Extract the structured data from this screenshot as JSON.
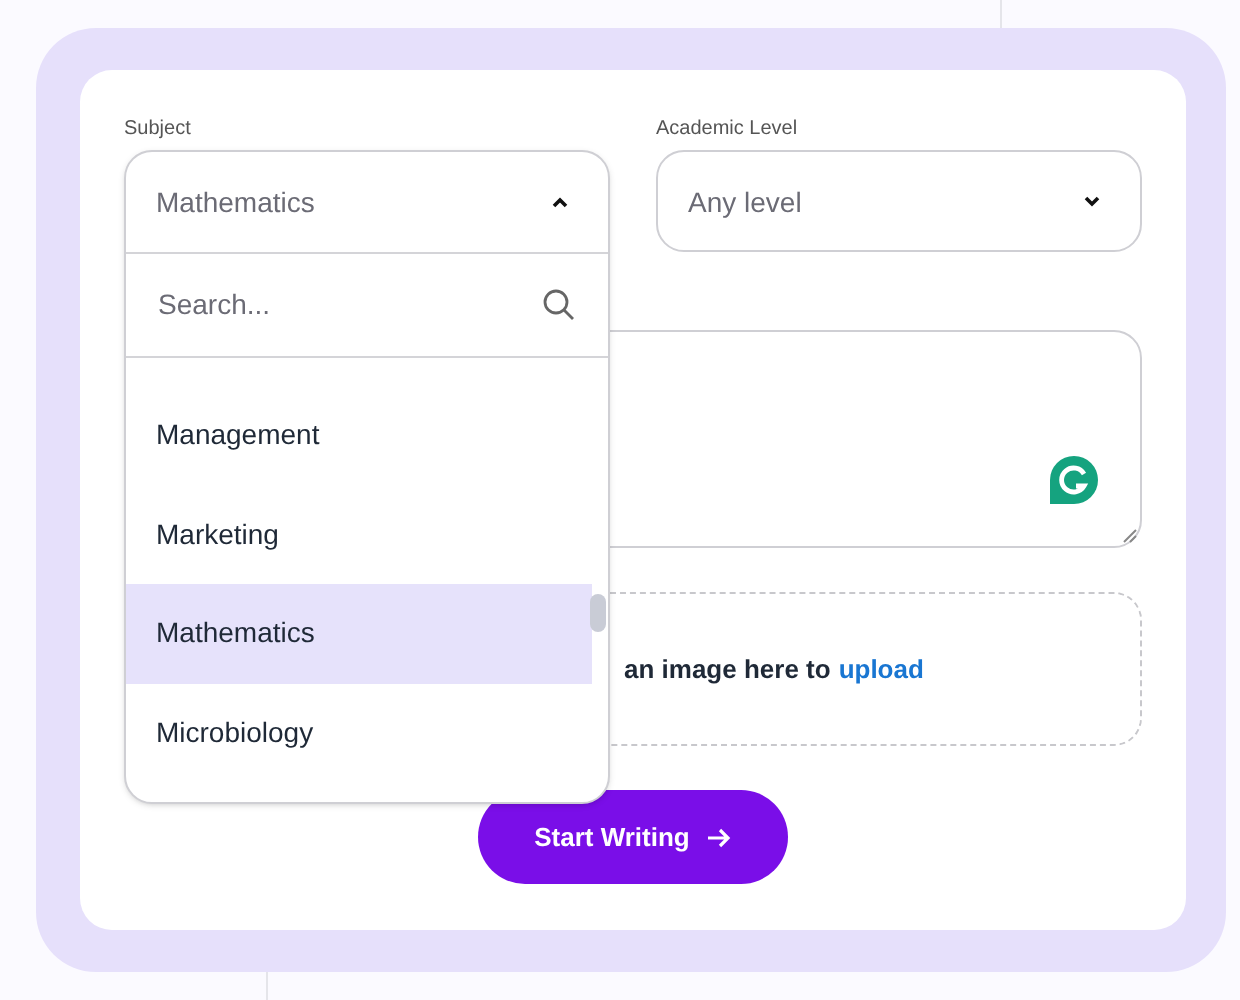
{
  "form": {
    "subject": {
      "label": "Subject",
      "value": "Mathematics",
      "expanded": true,
      "search_placeholder": "Search...",
      "options": [
        {
          "label": "Management",
          "selected": false
        },
        {
          "label": "Marketing",
          "selected": false
        },
        {
          "label": "Mathematics",
          "selected": true
        },
        {
          "label": "Microbiology",
          "selected": false
        }
      ]
    },
    "academic_level": {
      "label": "Academic Level",
      "value": "Any level",
      "expanded": false
    },
    "upload": {
      "text": "an image here to",
      "link": "upload"
    },
    "submit_button": "Start Writing"
  }
}
